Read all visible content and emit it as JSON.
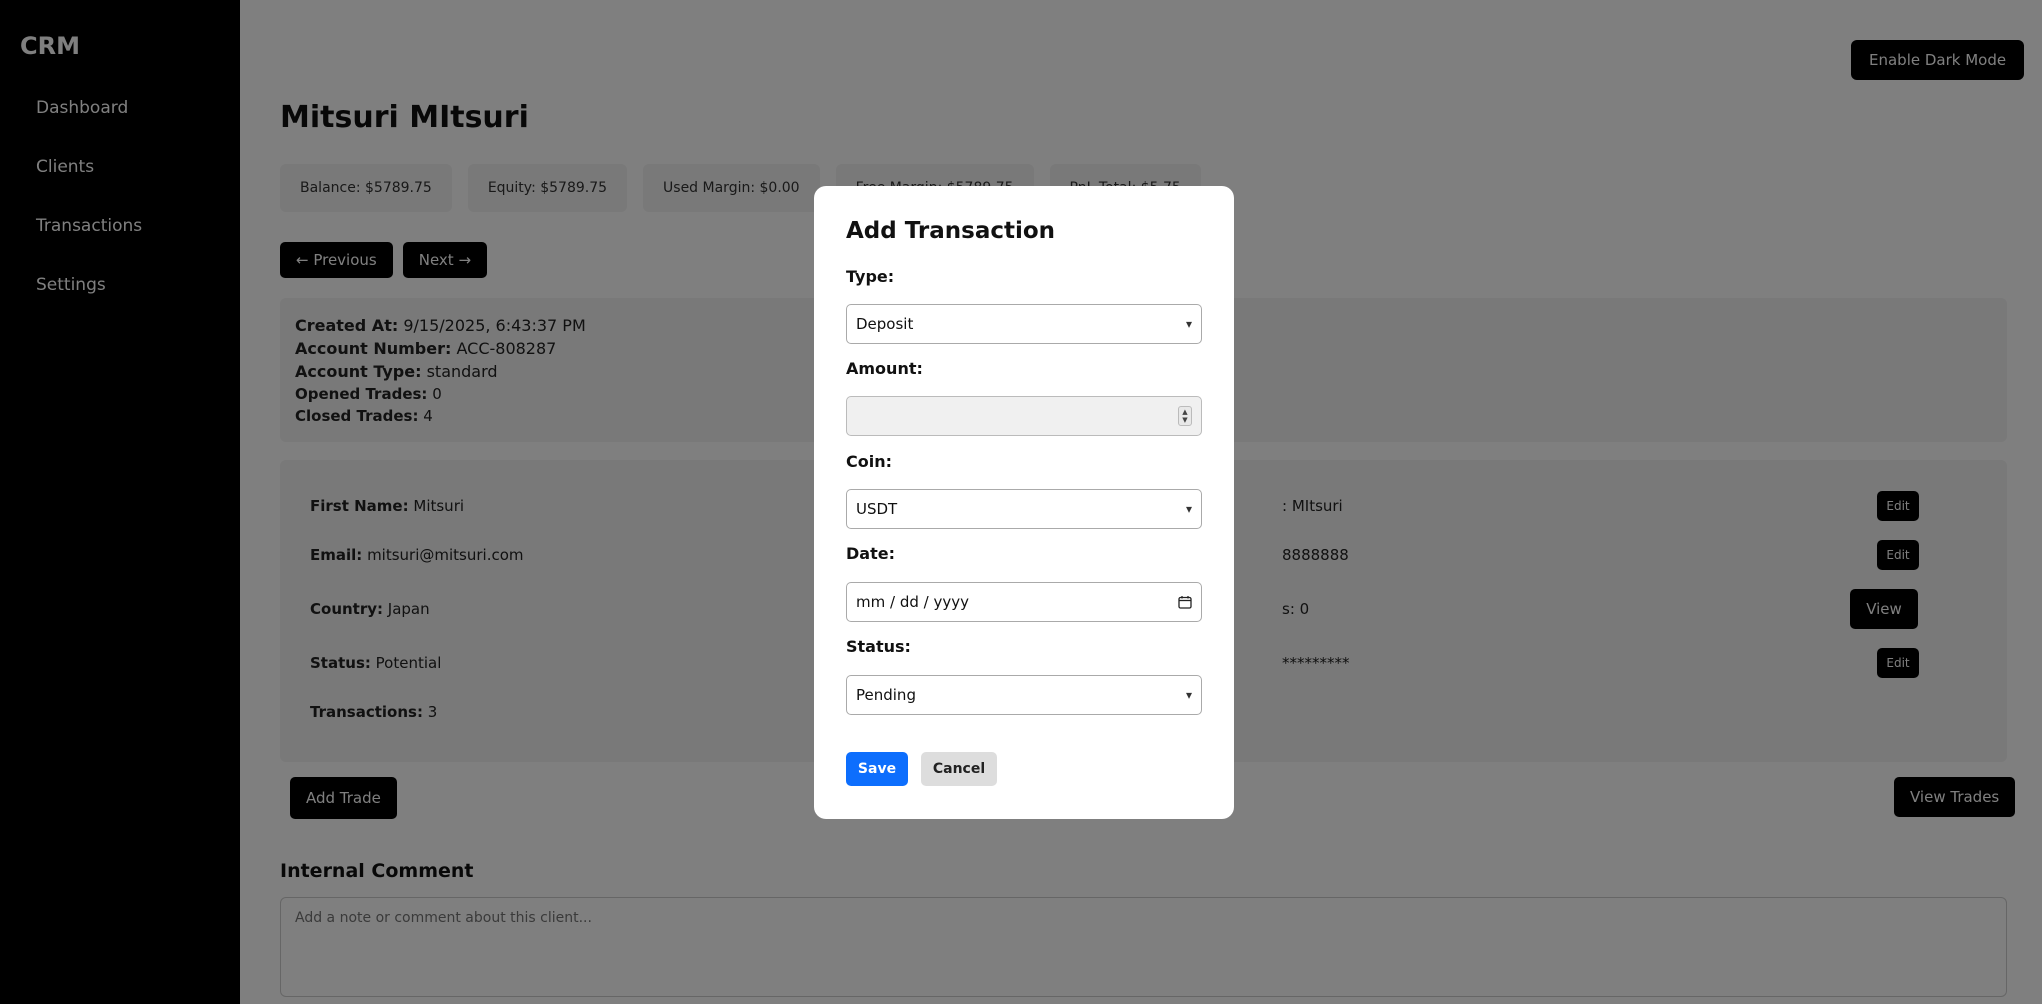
{
  "sidebar": {
    "logo": "CRM",
    "items": [
      {
        "label": "Dashboard"
      },
      {
        "label": "Clients"
      },
      {
        "label": "Transactions"
      },
      {
        "label": "Settings"
      }
    ]
  },
  "header": {
    "dark_mode_label": "Enable Dark Mode",
    "title": "Mitsuri MItsuri"
  },
  "stats": [
    {
      "label": "Balance: $5789.75"
    },
    {
      "label": "Equity: $5789.75"
    },
    {
      "label": "Used Margin: $0.00"
    },
    {
      "label": "Free Margin: $5789.75"
    },
    {
      "label": "PnL Total: $5.75"
    }
  ],
  "pager": {
    "previous": "← Previous",
    "next": "Next →"
  },
  "account": {
    "created_label": "Created At:",
    "created_value": "9/15/2025, 6:43:37 PM",
    "number_label": "Account Number:",
    "number_value": "ACC-808287",
    "type_label": "Account Type:",
    "type_value": "standard",
    "opened_label": "Opened Trades:",
    "opened_value": "0",
    "closed_label": "Closed Trades:",
    "closed_value": "4"
  },
  "details": {
    "first_name_label": "First Name:",
    "first_name_value": "Mitsuri",
    "last_name_partial": ": MItsuri",
    "email_label": "Email:",
    "email_value": "mitsuri@mitsuri.com",
    "phone_partial": "8888888",
    "country_label": "Country:",
    "country_value": "Japan",
    "docs_partial": "s: 0",
    "status_label": "Status:",
    "status_value": "Potential",
    "password_partial": "*********",
    "transactions_label": "Transactions:",
    "transactions_value": "3",
    "edit_label": "Edit",
    "view_label": "View"
  },
  "actions": {
    "add_trade": "Add Trade",
    "view_trades": "View Trades"
  },
  "comment": {
    "title": "Internal Comment",
    "placeholder": "Add a note or comment about this client..."
  },
  "modal": {
    "title": "Add Transaction",
    "type_label": "Type:",
    "type_value": "Deposit",
    "amount_label": "Amount:",
    "amount_value": "",
    "coin_label": "Coin:",
    "coin_value": "USDT",
    "date_label": "Date:",
    "date_placeholder": "mm / dd / yyyy",
    "status_label": "Status:",
    "status_value": "Pending",
    "save_label": "Save",
    "cancel_label": "Cancel"
  }
}
